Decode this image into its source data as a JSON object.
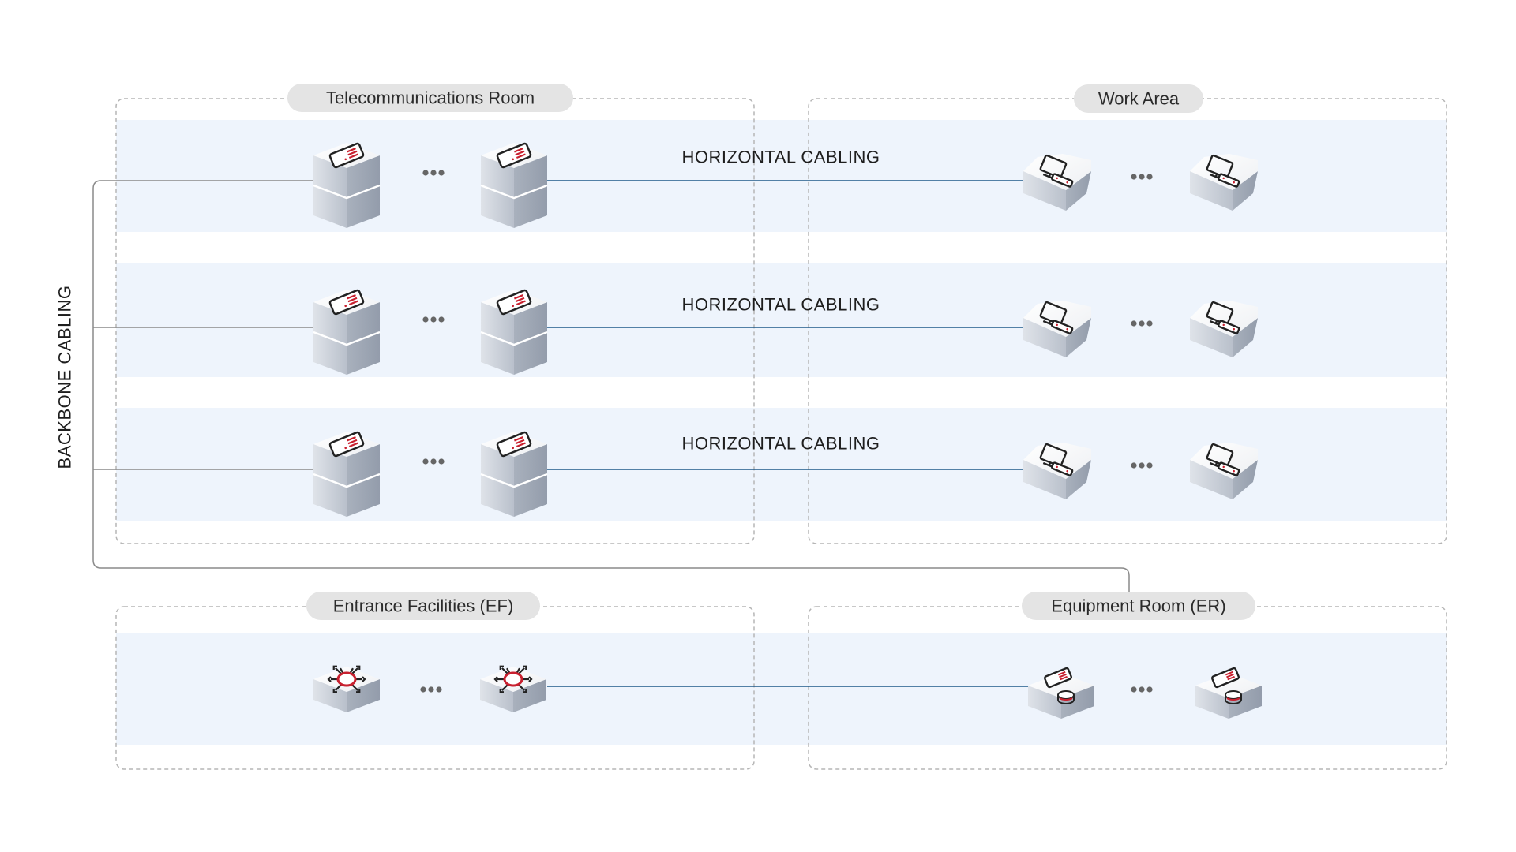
{
  "zones": {
    "telecom_room": "Telecommunications Room",
    "work_area": "Work Area",
    "entrance_facilities": "Entrance Facilities (EF)",
    "equipment_room": "Equipment Room (ER)"
  },
  "backbone_label": "BACKBONE CABLING",
  "horizontal_labels": [
    "HORIZONTAL CABLING",
    "HORIZONTAL CABLING",
    "HORIZONTAL CABLING"
  ],
  "ellipsis": "…",
  "icons": {
    "telecom": "stacked-server-cube-icon",
    "work_area": "workstation-computer-icon",
    "entrance": "network-hub-icon",
    "equipment": "server-database-icon"
  },
  "colors": {
    "band": "#eef4fc",
    "horizontal_cable": "#1f5a8a",
    "backbone_cable": "#8a8a8a",
    "accent": "#c8202f",
    "pill": "#e4e4e4"
  }
}
